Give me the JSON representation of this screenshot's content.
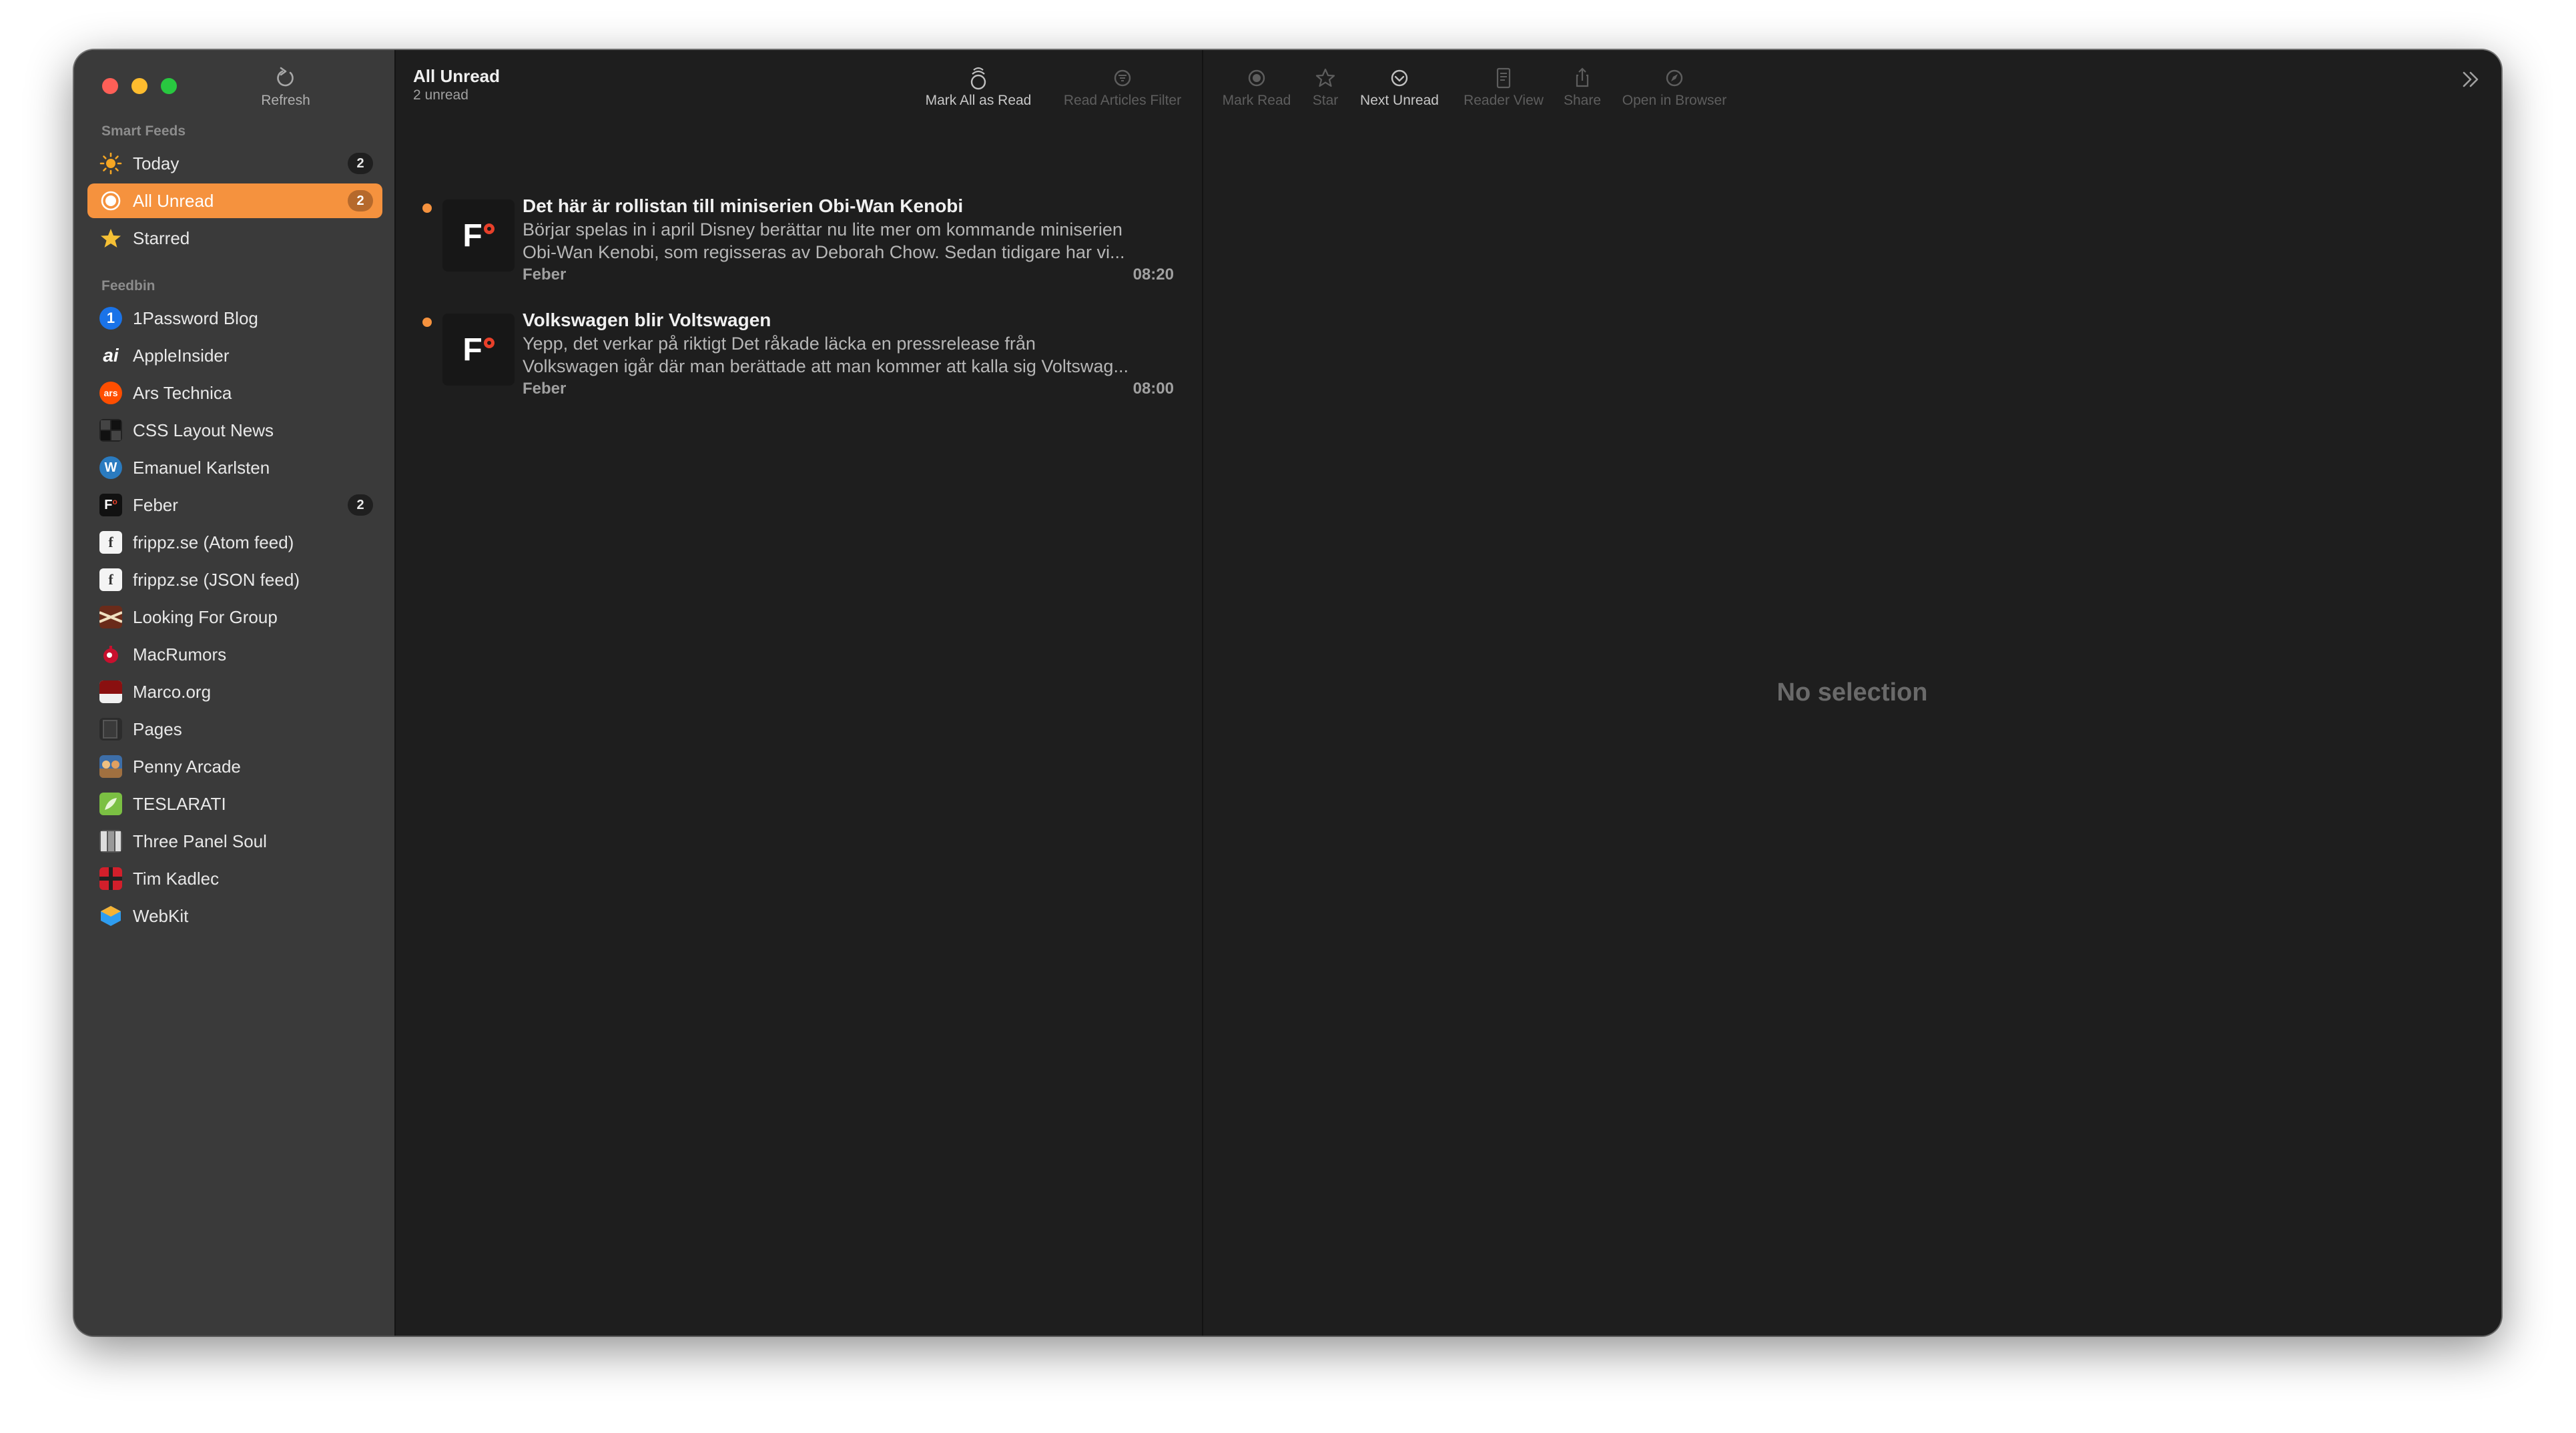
{
  "window": {
    "title": "All Unread"
  },
  "sidebar": {
    "refresh_label": "Refresh",
    "smart_feeds_header": "Smart Feeds",
    "smart_feeds": [
      {
        "label": "Today",
        "count": "2",
        "icon": "sun-icon"
      },
      {
        "label": "All Unread",
        "count": "2",
        "icon": "unread-circle-icon",
        "selected": true
      },
      {
        "label": "Starred",
        "count": "",
        "icon": "star-icon"
      }
    ],
    "feedbin_header": "Feedbin",
    "feeds": [
      {
        "label": "1Password Blog",
        "count": "",
        "color": "#1a73e8"
      },
      {
        "label": "AppleInsider",
        "count": "",
        "color": "#3a3a3a"
      },
      {
        "label": "Ars Technica",
        "count": "",
        "color": "#ff4e00"
      },
      {
        "label": "CSS Layout News",
        "count": "",
        "color": "#222222"
      },
      {
        "label": "Emanuel Karlsten",
        "count": "",
        "color": "#2a7bc0"
      },
      {
        "label": "Feber",
        "count": "2",
        "color": "#111111"
      },
      {
        "label": "frippz.se (Atom feed)",
        "count": "",
        "color": "#f4f4f4"
      },
      {
        "label": "frippz.se (JSON feed)",
        "count": "",
        "color": "#f4f4f4"
      },
      {
        "label": "Looking For Group",
        "count": "",
        "color": "#6a2b1a"
      },
      {
        "label": "MacRumors",
        "count": "",
        "color": "#c8102e"
      },
      {
        "label": "Marco.org",
        "count": "",
        "color": "#8a1010"
      },
      {
        "label": "Pages",
        "count": "",
        "color": "#2c2c2c"
      },
      {
        "label": "Penny Arcade",
        "count": "",
        "color": "#3d6ea8"
      },
      {
        "label": "TESLARATI",
        "count": "",
        "color": "#7bc043"
      },
      {
        "label": "Three Panel Soul",
        "count": "",
        "color": "#555555"
      },
      {
        "label": "Tim Kadlec",
        "count": "",
        "color": "#d21f2b"
      },
      {
        "label": "WebKit",
        "count": "",
        "color": "#2e9df0"
      }
    ]
  },
  "list": {
    "title": "All Unread",
    "subtitle": "2 unread",
    "toolbar": {
      "mark_all_read": "Mark All as Read",
      "read_filter": "Read Articles Filter"
    },
    "articles": [
      {
        "title": "Det här är rollistan till miniserien Obi-Wan Kenobi",
        "line1": "Börjar spelas in i april Disney berättar nu lite mer om kommande miniserien",
        "line2": "Obi-Wan Kenobi, som regisseras av Deborah Chow. Sedan tidigare har vi...",
        "source": "Feber",
        "time": "08:20",
        "unread": true
      },
      {
        "title": "Volkswagen blir Voltswagen",
        "line1": "Yepp, det verkar på riktigt Det råkade läcka en pressrelease från",
        "line2": "Volkswagen igår där man berättade att man kommer att kalla sig Voltswag...",
        "source": "Feber",
        "time": "08:00",
        "unread": true
      }
    ]
  },
  "detail": {
    "toolbar": {
      "mark_read": "Mark Read",
      "star": "Star",
      "next_unread": "Next Unread",
      "reader_view": "Reader View",
      "share": "Share",
      "open_browser": "Open in Browser"
    },
    "empty_text": "No selection"
  },
  "colors": {
    "accent": "#f5923e",
    "sidebar_bg": "#3a3a3a",
    "content_bg": "#1e1e1e"
  }
}
